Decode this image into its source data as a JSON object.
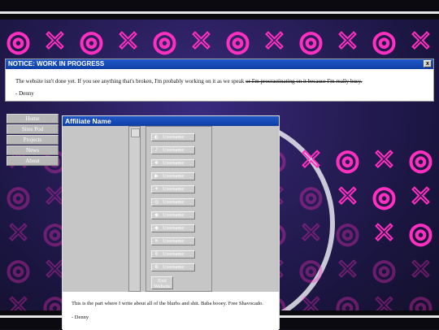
{
  "notice": {
    "title": "NOTICE: WORK IN PROGRESS",
    "close_label": "x",
    "message": "The website isn't done yet. If you see anything that's broken, I'm probably working on it as we speak ",
    "struck_text": "or I'm procrastinating on it because I'm really busy.",
    "signature": "- Denny"
  },
  "nav": {
    "items": [
      {
        "label": "Home"
      },
      {
        "label": "Sites Pod"
      },
      {
        "label": "Projects"
      },
      {
        "label": "News"
      },
      {
        "label": "About"
      }
    ]
  },
  "affiliate": {
    "title": "Affiliate Name",
    "links": [
      {
        "icon": "discord-icon",
        "glyph": "◐",
        "label": "Username"
      },
      {
        "icon": "tiktok-icon",
        "glyph": "♪",
        "label": "Username"
      },
      {
        "icon": "bluesky-icon",
        "glyph": "❖",
        "label": "Username"
      },
      {
        "icon": "youtube-icon",
        "glyph": "▶",
        "label": "Username"
      },
      {
        "icon": "twitter-icon",
        "glyph": "✦",
        "label": "Username"
      },
      {
        "icon": "instagram-icon",
        "glyph": "◎",
        "label": "Username"
      },
      {
        "icon": "discord-chat-icon",
        "glyph": "◉",
        "label": "Username"
      },
      {
        "icon": "playstation-icon",
        "glyph": "◆",
        "label": "Username"
      },
      {
        "icon": "xbox-icon",
        "glyph": "✕",
        "label": "Username"
      },
      {
        "icon": "nintendo-icon",
        "glyph": "Ⅱ",
        "label": "Username"
      },
      {
        "icon": "steam-icon",
        "glyph": "⚙",
        "label": "Username"
      }
    ],
    "exit_label": "Exit Website",
    "blurb": "This is the part where I write about all of the blurbs and shit. Baba booey. Free Shavocado.",
    "signature": "- Denny"
  },
  "colors": {
    "titlebar": "#1f58c8",
    "pattern_pink": "#ff2fbf",
    "background_purple": "#2a1f5c"
  }
}
